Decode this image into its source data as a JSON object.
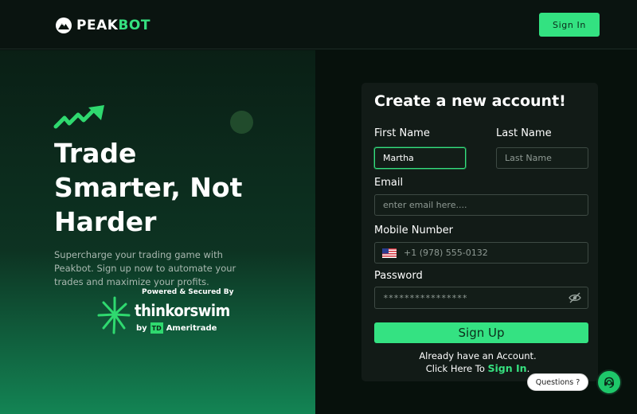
{
  "header": {
    "logo_peak": "PEAK",
    "logo_bot": "BOT",
    "sign_in_label": "Sign In"
  },
  "hero": {
    "title_line1": "Trade",
    "title_line2": "Smarter, Not",
    "title_line3": "Harder",
    "subtitle": "Supercharge your trading game with Peakbot. Sign up now to automate your trades and maximize your profits.",
    "powered_by": "Powered & Secured By",
    "partner_name": "thinkorswim",
    "partner_by": "by",
    "partner_td": "TD",
    "partner_company": "Ameritrade"
  },
  "form": {
    "title": "Create a new account!",
    "first_name_label": "First Name",
    "first_name_value": "Martha",
    "last_name_label": "Last Name",
    "last_name_placeholder": "Last Name",
    "email_label": "Email",
    "email_placeholder": "enter email here....",
    "mobile_label": "Mobile Number",
    "mobile_placeholder": "+1 (978) 555-0132",
    "password_label": "Password",
    "password_placeholder": "****************",
    "submit_label": "Sign Up",
    "already_text": "Already have an Account.",
    "click_here_text": "Click Here To",
    "sign_in_link": "Sign In",
    "period": "."
  },
  "support": {
    "questions_label": "Questions ?"
  },
  "colors": {
    "accent": "#34e282",
    "background": "#08120e",
    "card": "#121b17"
  }
}
